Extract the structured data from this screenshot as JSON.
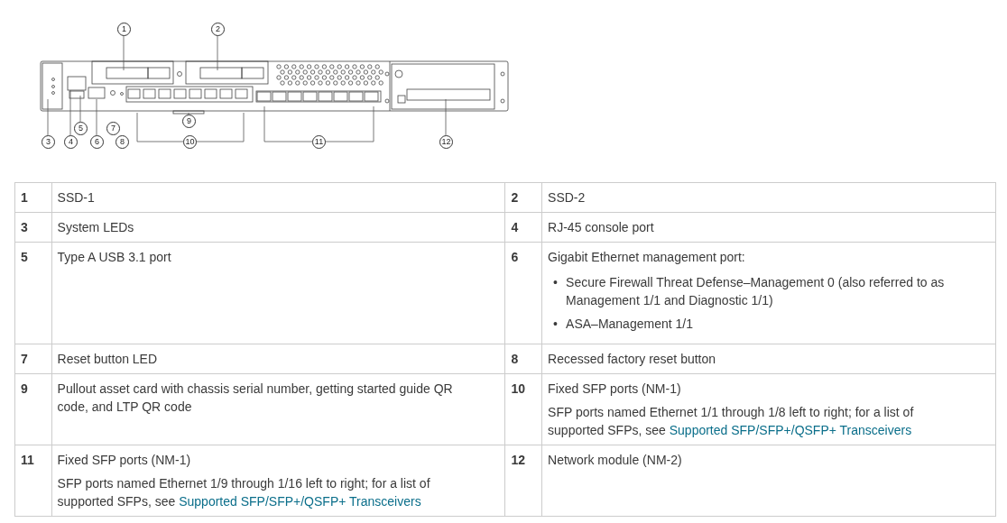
{
  "diagram": {
    "callouts": [
      "1",
      "2",
      "3",
      "4",
      "5",
      "6",
      "7",
      "8",
      "9",
      "10",
      "11",
      "12"
    ]
  },
  "table": {
    "rows": [
      {
        "items": [
          {
            "number": "1",
            "label": "SSD-1"
          },
          {
            "number": "2",
            "label": "SSD-2"
          }
        ]
      },
      {
        "items": [
          {
            "number": "3",
            "label": "System LEDs"
          },
          {
            "number": "4",
            "label": "RJ-45 console port"
          }
        ]
      },
      {
        "items": [
          {
            "number": "5",
            "label": "Type A USB 3.1 port"
          },
          {
            "number": "6",
            "label": "Gigabit Ethernet management port:",
            "bullets": [
              {
                "marker": "•",
                "text": "Secure Firewall Threat Defense–Management 0 (also referred to as Management 1/1 and Diagnostic 1/1)"
              },
              {
                "marker": "•",
                "text": "ASA–Management 1/1"
              }
            ]
          }
        ]
      },
      {
        "items": [
          {
            "number": "7",
            "label": "Reset button LED"
          },
          {
            "number": "8",
            "label": "Recessed factory reset button"
          }
        ]
      },
      {
        "items": [
          {
            "number": "9",
            "label": "Pullout asset card with chassis serial number, getting started guide QR code, and LTP QR code"
          },
          {
            "number": "10",
            "label": "Fixed SFP ports (NM-1)",
            "detail": {
              "text": "SFP ports named Ethernet 1/1 through 1/8 left to right; for a list of supported SFPs, see",
              "link": "Supported SFP/SFP+/QSFP+ Transceivers"
            }
          }
        ]
      },
      {
        "items": [
          {
            "number": "11",
            "label": "Fixed SFP ports (NM-1)",
            "detail": {
              "text": "SFP ports named Ethernet 1/9 through 1/16 left to right; for a list of supported SFPs, see",
              "link": "Supported SFP/SFP+/QSFP+ Transceivers"
            }
          },
          {
            "number": "12",
            "label": "Network module (NM-2)"
          }
        ]
      }
    ]
  }
}
